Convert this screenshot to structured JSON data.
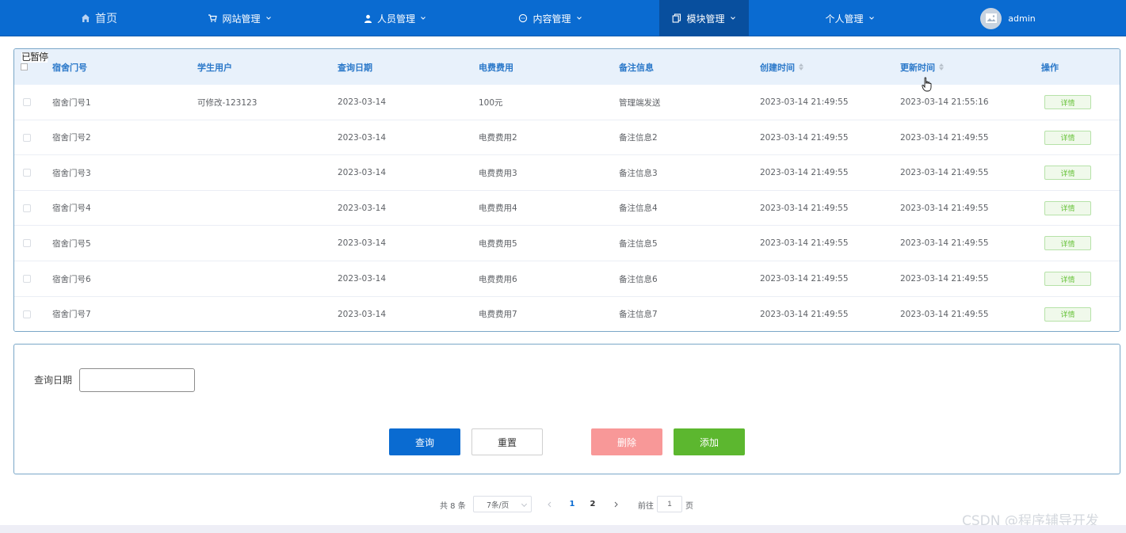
{
  "nav": {
    "home": "首页",
    "items": [
      {
        "label": "网站管理"
      },
      {
        "label": "人员管理"
      },
      {
        "label": "内容管理"
      },
      {
        "label": "模块管理"
      },
      {
        "label": "个人管理"
      }
    ],
    "user": "admin",
    "active": "模块管理"
  },
  "overlay_text": "已暂停",
  "table": {
    "headers": [
      "宿舍门号",
      "学生用户",
      "查询日期",
      "电费费用",
      "备注信息",
      "创建时间",
      "更新时间",
      "操作"
    ],
    "rows": [
      {
        "dorm": "宿舍门号1",
        "student": "可修改-123123",
        "date": "2023-03-14",
        "fee": "100元",
        "note": "管理端发送",
        "created": "2023-03-14 21:49:55",
        "updated": "2023-03-14 21:55:16",
        "action": "详情"
      },
      {
        "dorm": "宿舍门号2",
        "student": "",
        "date": "2023-03-14",
        "fee": "电费费用2",
        "note": "备注信息2",
        "created": "2023-03-14 21:49:55",
        "updated": "2023-03-14 21:49:55",
        "action": "详情"
      },
      {
        "dorm": "宿舍门号3",
        "student": "",
        "date": "2023-03-14",
        "fee": "电费费用3",
        "note": "备注信息3",
        "created": "2023-03-14 21:49:55",
        "updated": "2023-03-14 21:49:55",
        "action": "详情"
      },
      {
        "dorm": "宿舍门号4",
        "student": "",
        "date": "2023-03-14",
        "fee": "电费费用4",
        "note": "备注信息4",
        "created": "2023-03-14 21:49:55",
        "updated": "2023-03-14 21:49:55",
        "action": "详情"
      },
      {
        "dorm": "宿舍门号5",
        "student": "",
        "date": "2023-03-14",
        "fee": "电费费用5",
        "note": "备注信息5",
        "created": "2023-03-14 21:49:55",
        "updated": "2023-03-14 21:49:55",
        "action": "详情"
      },
      {
        "dorm": "宿舍门号6",
        "student": "",
        "date": "2023-03-14",
        "fee": "电费费用6",
        "note": "备注信息6",
        "created": "2023-03-14 21:49:55",
        "updated": "2023-03-14 21:49:55",
        "action": "详情"
      },
      {
        "dorm": "宿舍门号7",
        "student": "",
        "date": "2023-03-14",
        "fee": "电费费用7",
        "note": "备注信息7",
        "created": "2023-03-14 21:49:55",
        "updated": "2023-03-14 21:49:55",
        "action": "详情"
      }
    ]
  },
  "search": {
    "label": "查询日期",
    "value": "",
    "buttons": {
      "query": "查询",
      "reset": "重置",
      "delete": "删除",
      "add": "添加"
    }
  },
  "pagination": {
    "total": "共 8 条",
    "page_size": "7条/页",
    "pages": [
      "1",
      "2"
    ],
    "current": "1",
    "goto_label": "前往",
    "goto_value": "1",
    "page_suffix": "页"
  },
  "watermark": "CSDN @程序辅导开发",
  "colors": {
    "nav": "#0a6bd1",
    "active_nav": "#084f9e",
    "header_text": "#2a78c9",
    "add": "#5cb72f",
    "delete": "#f89898"
  }
}
